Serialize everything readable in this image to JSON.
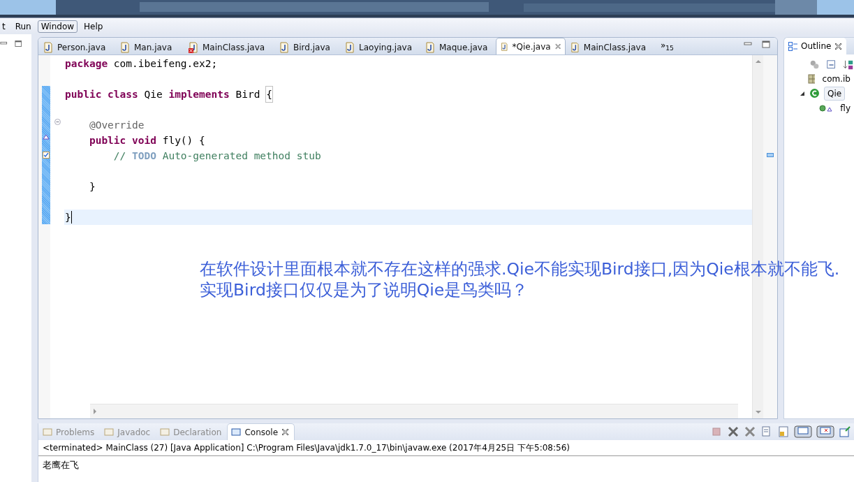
{
  "menu": [
    {
      "label": "t",
      "selected": false
    },
    {
      "label": "Run",
      "selected": false
    },
    {
      "label": "Window",
      "selected": true
    },
    {
      "label": "Help",
      "selected": false
    }
  ],
  "editor": {
    "tabs": [
      {
        "label": "Person.java",
        "selected": false,
        "error": false
      },
      {
        "label": "Man.java",
        "selected": false,
        "error": false
      },
      {
        "label": "MainClass.java",
        "selected": false,
        "error": true
      },
      {
        "label": "Bird.java",
        "selected": false,
        "error": false
      },
      {
        "label": "Laoying.java",
        "selected": false,
        "error": false
      },
      {
        "label": "Maque.java",
        "selected": false,
        "error": false
      },
      {
        "label": "*Qie.java",
        "selected": true,
        "error": false
      },
      {
        "label": "MainClass.java",
        "selected": false,
        "error": false
      }
    ],
    "overflow": {
      "glyph": "»",
      "count": "15"
    },
    "lines": [
      {
        "current": false,
        "tokens": [
          {
            "kind": "keyword",
            "text": "package"
          },
          {
            "kind": "plain",
            "text": " com.ibeifeng.ex2;"
          }
        ]
      },
      {
        "current": false
      },
      {
        "current": false,
        "tokens": [
          {
            "kind": "keyword",
            "text": "public class"
          },
          {
            "kind": "plain",
            "text": " Qie "
          },
          {
            "kind": "keyword",
            "text": "implements"
          },
          {
            "kind": "plain",
            "text": " Bird "
          },
          {
            "kind": "bracket",
            "text": "{"
          }
        ]
      },
      {
        "current": false
      },
      {
        "current": false,
        "tokens": [
          {
            "kind": "annotation",
            "text": "    @Override"
          }
        ]
      },
      {
        "current": false,
        "tokens": [
          {
            "kind": "keyword",
            "text": "    public void"
          },
          {
            "kind": "plain",
            "text": " fly() {"
          }
        ]
      },
      {
        "current": false,
        "tokens": [
          {
            "kind": "comment",
            "text": "        // "
          },
          {
            "kind": "todo",
            "text": "TODO"
          },
          {
            "kind": "comment",
            "text": " Auto-generated method stub"
          }
        ]
      },
      {
        "current": false
      },
      {
        "current": false,
        "tokens": [
          {
            "kind": "plain",
            "text": "    }"
          }
        ]
      },
      {
        "current": false
      },
      {
        "current": true,
        "tokens": [
          {
            "kind": "plain",
            "text": "}"
          }
        ]
      }
    ]
  },
  "annotation": "在软件设计里面根本就不存在这样的强求.Qie不能实现Bird接口,因为Qie根本就不能飞.实现Bird接口仅仅是为了说明Qie是鸟类吗？",
  "outline": {
    "title": "Outline",
    "items": [
      {
        "kind": "package",
        "label": "com.ib",
        "selected": false
      },
      {
        "kind": "class",
        "label": "Qie",
        "expanded": true,
        "selected": true,
        "children": [
          {
            "kind": "method",
            "label": "fly",
            "selected": false
          }
        ]
      }
    ]
  },
  "console": {
    "tabs": [
      {
        "label": "Problems",
        "selected": false,
        "closable": false
      },
      {
        "label": "Javadoc",
        "selected": false,
        "closable": false
      },
      {
        "label": "Declaration",
        "selected": false,
        "closable": false
      },
      {
        "label": "Console",
        "selected": true,
        "closable": true
      }
    ],
    "header": "<terminated> MainClass (27) [Java Application] C:\\Program Files\\Java\\jdk1.7.0_17\\bin\\javaw.exe (2017年4月25日 下午5:08:56)",
    "output": "老鹰在飞"
  }
}
